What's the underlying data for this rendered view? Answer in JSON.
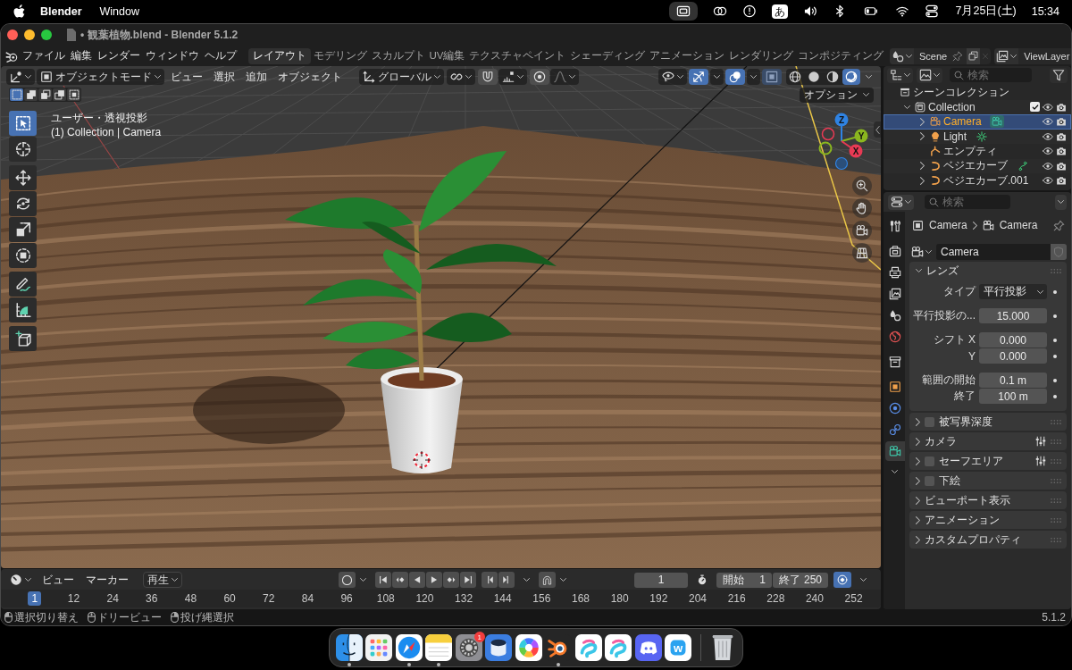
{
  "menubar": {
    "app": "Blender",
    "menus": [
      "Window"
    ],
    "input_source": "あ",
    "date": "7月25日(土)",
    "time": "15:34"
  },
  "window": {
    "title": "• 観葉植物.blend - Blender 5.1.2"
  },
  "topbar": {
    "menus": [
      "ファイル",
      "編集",
      "レンダー",
      "ウィンドウ",
      "ヘルプ"
    ],
    "workspaces": [
      {
        "label": "レイアウト",
        "selected": true
      },
      {
        "label": "モデリング",
        "selected": false
      },
      {
        "label": "スカルプト",
        "selected": false
      },
      {
        "label": "UV編集",
        "selected": false
      },
      {
        "label": "テクスチャペイント",
        "selected": false
      },
      {
        "label": "シェーディング",
        "selected": false
      },
      {
        "label": "アニメーション",
        "selected": false
      },
      {
        "label": "レンダリング",
        "selected": false
      },
      {
        "label": "コンポジティング",
        "selected": false
      }
    ],
    "scene": "Scene",
    "view_layer": "ViewLayer"
  },
  "viewport": {
    "mode": "オブジェクトモード",
    "menus": [
      "ビュー",
      "選択",
      "追加",
      "オブジェクト"
    ],
    "orientation": "グローバル",
    "toggles": [
      {
        "kind": "gizmo",
        "on": true,
        "disabled": false
      },
      {
        "kind": "overlay",
        "on": true,
        "disabled": false
      },
      {
        "kind": "xray",
        "on": true,
        "disabled": true
      }
    ],
    "shading": [
      {
        "kind": "wireframe",
        "selected": false
      },
      {
        "kind": "solid",
        "selected": false
      },
      {
        "kind": "material",
        "selected": false
      },
      {
        "kind": "rendered",
        "selected": true
      }
    ],
    "select_modes": [
      {
        "kind": "set",
        "selected": true
      },
      {
        "kind": "extend",
        "selected": false
      },
      {
        "kind": "subtract",
        "selected": false
      },
      {
        "kind": "invert",
        "selected": false
      },
      {
        "kind": "intersect",
        "selected": false
      }
    ],
    "options": "オプション",
    "view_name": "ユーザー・透視投影",
    "context": "(1) Collection | Camera",
    "tools": [
      [
        {
          "kind": "select",
          "selected": true
        },
        {
          "kind": "cursor",
          "selected": false
        }
      ],
      [
        {
          "kind": "move",
          "selected": false
        },
        {
          "kind": "rotate",
          "selected": false
        },
        {
          "kind": "scale",
          "selected": false
        },
        {
          "kind": "transform",
          "selected": false
        }
      ],
      [
        {
          "kind": "annotate",
          "selected": false
        },
        {
          "kind": "measure",
          "selected": false
        }
      ],
      [
        {
          "kind": "add",
          "selected": false
        }
      ]
    ],
    "axes": [
      {
        "kind": "z",
        "label": "Z"
      },
      {
        "kind": "y",
        "label": "Y"
      },
      {
        "kind": "x",
        "label": "X"
      }
    ]
  },
  "outliner": {
    "search": {
      "placeholder": "検索"
    },
    "tree": [
      {
        "label": "シーンコレクション",
        "kind": "scene",
        "selected": false,
        "children": [
          {
            "label": "Collection",
            "kind": "collection",
            "expanded": true,
            "checked": true,
            "selected": false,
            "children": [
              {
                "label": "Camera",
                "kind": "camera",
                "expanded": false,
                "selected": true,
                "shows_data": true
              },
              {
                "label": "Light",
                "kind": "light",
                "expanded": false,
                "selected": false,
                "shows_data": true
              },
              {
                "label": "エンプティ",
                "kind": "empty",
                "selected": false,
                "shows_data": false
              },
              {
                "label": "ベジエカーブ",
                "kind": "curve",
                "expanded": false,
                "selected": false,
                "shows_data": true
              },
              {
                "label": "ベジエカーブ.001",
                "kind": "curve",
                "expanded": false,
                "selected": false,
                "shows_data": false
              }
            ]
          }
        ]
      }
    ]
  },
  "properties": {
    "search": {
      "placeholder": "検索"
    },
    "tabs": [
      [
        {
          "kind": "tool",
          "selected": false
        }
      ],
      [
        {
          "kind": "render",
          "selected": false
        },
        {
          "kind": "output",
          "selected": false
        },
        {
          "kind": "viewlayer",
          "selected": false
        },
        {
          "kind": "scene",
          "selected": false
        },
        {
          "kind": "world",
          "selected": false
        }
      ],
      [
        {
          "kind": "collection",
          "selected": false
        }
      ],
      [
        {
          "kind": "object",
          "selected": false
        },
        {
          "kind": "physics",
          "selected": false
        },
        {
          "kind": "constraints",
          "selected": false
        },
        {
          "kind": "data",
          "selected": true
        }
      ]
    ],
    "breadcrumb": [
      "Camera",
      "Camera"
    ],
    "datablock": "Camera",
    "panels": [
      {
        "title": "レンズ",
        "expanded": true,
        "groups": [
          [
            {
              "label": "タイプ",
              "value": "平行投影",
              "kind": "dropdown"
            }
          ],
          [
            {
              "label": "平行投影の...",
              "value": "15.000",
              "kind": "number"
            }
          ],
          [
            {
              "label": "シフト X",
              "value": "0.000",
              "kind": "number"
            },
            {
              "label": "Y",
              "value": "0.000",
              "kind": "number"
            }
          ],
          [
            {
              "label": "範囲の開始",
              "value": "0.1 m",
              "kind": "number"
            },
            {
              "label": "終了",
              "value": "100 m",
              "kind": "number"
            }
          ]
        ]
      },
      {
        "title": "被写界深度",
        "expanded": false,
        "checked": false
      },
      {
        "title": "カメラ",
        "expanded": false,
        "presets": true
      },
      {
        "title": "セーフエリア",
        "expanded": false,
        "checked": false,
        "presets": true
      },
      {
        "title": "下絵",
        "expanded": false,
        "checked": false
      },
      {
        "title": "ビューポート表示",
        "expanded": false
      },
      {
        "title": "アニメーション",
        "expanded": false
      },
      {
        "title": "カスタムプロパティ",
        "expanded": false
      }
    ]
  },
  "timeline": {
    "menus": [
      "ビュー",
      "マーカー"
    ],
    "playback": "再生",
    "current_frame": "1",
    "start_label": "開始",
    "start": "1",
    "end_label": "終了",
    "end": "250",
    "frames": [
      {
        "label": "1",
        "selected": true
      },
      {
        "label": "12",
        "selected": false
      },
      {
        "label": "24",
        "selected": false
      },
      {
        "label": "36",
        "selected": false
      },
      {
        "label": "48",
        "selected": false
      },
      {
        "label": "60",
        "selected": false
      },
      {
        "label": "72",
        "selected": false
      },
      {
        "label": "84",
        "selected": false
      },
      {
        "label": "96",
        "selected": false
      },
      {
        "label": "108",
        "selected": false
      },
      {
        "label": "120",
        "selected": false
      },
      {
        "label": "132",
        "selected": false
      },
      {
        "label": "144",
        "selected": false
      },
      {
        "label": "156",
        "selected": false
      },
      {
        "label": "168",
        "selected": false
      },
      {
        "label": "180",
        "selected": false
      },
      {
        "label": "192",
        "selected": false
      },
      {
        "label": "204",
        "selected": false
      },
      {
        "label": "216",
        "selected": false
      },
      {
        "label": "228",
        "selected": false
      },
      {
        "label": "240",
        "selected": false
      },
      {
        "label": "252",
        "selected": false
      }
    ]
  },
  "statusbar": {
    "hints": [
      {
        "kind": "left",
        "label": "選択切り替え"
      },
      {
        "kind": "middle",
        "label": "ドリービュー"
      },
      {
        "kind": "right",
        "label": "投げ縄選択"
      }
    ],
    "version": "5.1.2"
  },
  "dock": {
    "apps": [
      {
        "kind": "finder",
        "running": true
      },
      {
        "kind": "launchpad",
        "running": false
      },
      {
        "kind": "compass",
        "running": true
      },
      {
        "kind": "notes",
        "running": true
      },
      {
        "kind": "settings",
        "running": false,
        "badge": "1"
      },
      {
        "kind": "disk",
        "running": false
      },
      {
        "kind": "colorwheel",
        "running": false
      },
      {
        "kind": "blender",
        "running": true
      },
      {
        "kind": "paint",
        "running": false
      },
      {
        "kind": "paint",
        "running": false
      },
      {
        "kind": "chat",
        "running": false
      },
      {
        "kind": "letter",
        "running": false,
        "glyph": "w"
      }
    ]
  }
}
